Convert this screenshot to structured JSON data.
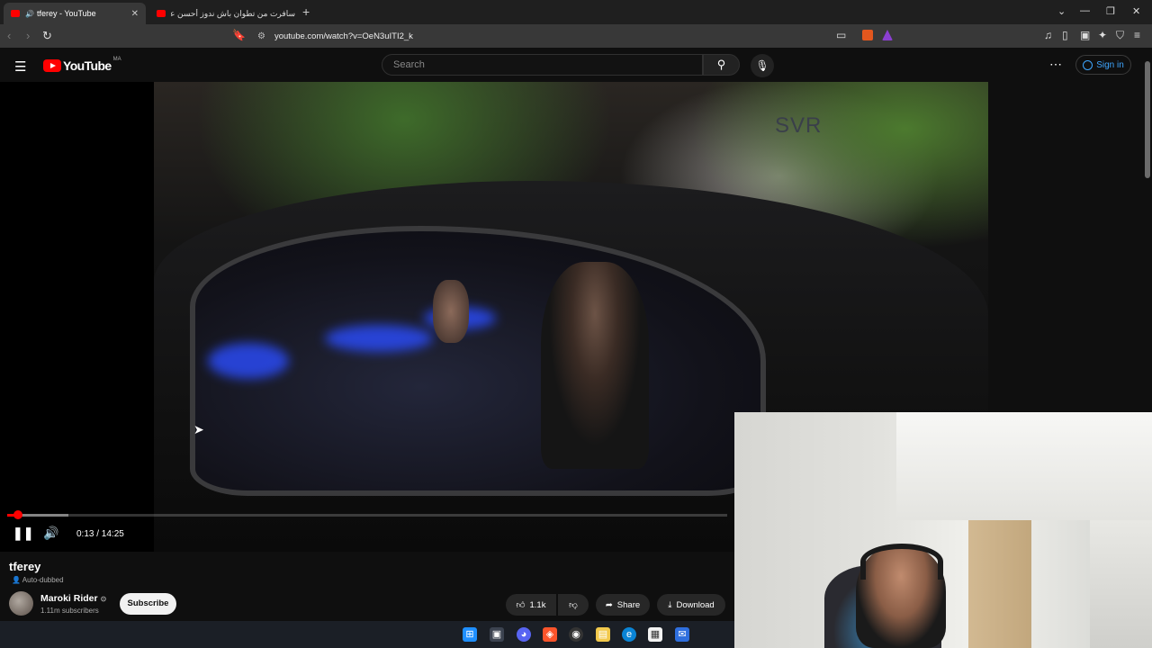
{
  "browser": {
    "tabs": [
      {
        "title": "tferey - YouTube",
        "active": true
      },
      {
        "title": "سافرت من تطوان باش ندوز أحسن عطلة",
        "active": false
      }
    ],
    "url": "youtube.com/watch?v=OeN3uITI2_k",
    "window_controls": [
      "⌄",
      "—",
      "❐",
      "✕"
    ]
  },
  "youtube": {
    "logo_text": "YouTube",
    "region": "MA",
    "search_placeholder": "Search",
    "sign_in": "Sign in"
  },
  "player": {
    "current_time": "0:13",
    "duration": "14:25",
    "time_display": "0:13 / 14:25",
    "played_fraction": 0.015,
    "buffered_fraction": 0.085,
    "video_sign_text": "SVR"
  },
  "video": {
    "title": "tferey",
    "dubbed_label": "Auto-dubbed",
    "channel_name": "Maroki Rider",
    "subscribers": "1.11m subscribers",
    "subscribe_label": "Subscribe",
    "likes": "1.1k",
    "share_label": "Share",
    "download_label": "Download"
  },
  "colors": {
    "youtube_red": "#ff0000",
    "link_blue": "#3ea6ff",
    "background": "#0f0f0f"
  }
}
